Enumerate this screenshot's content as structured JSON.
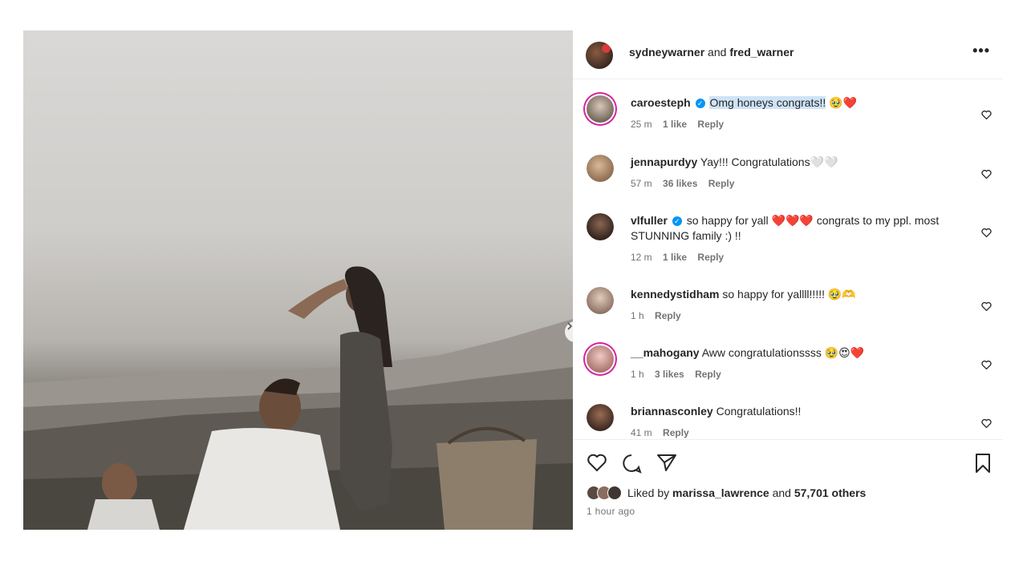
{
  "header": {
    "user1": "sydneywarner",
    "and_text": " and ",
    "user2": "fred_warner",
    "more_icon": "more-horizontal-icon"
  },
  "comments": [
    {
      "user": "caroesteph",
      "verified": true,
      "text": "Omg honeys congrats!!",
      "emoji": " 🥹❤️",
      "time": "25 m",
      "likes": "1 like",
      "reply": "Reply"
    },
    {
      "user": "jennapurdyy",
      "verified": false,
      "text": "Yay!!! Congratulations🤍🤍",
      "emoji": "",
      "time": "57 m",
      "likes": "36 likes",
      "reply": "Reply"
    },
    {
      "user": "vlfuller",
      "verified": true,
      "text": "so happy for yall ❤️❤️❤️ congrats to my ppl. most STUNNING family :) !!",
      "emoji": "",
      "time": "12 m",
      "likes": "1 like",
      "reply": "Reply"
    },
    {
      "user": "kennedystidham",
      "verified": false,
      "text": "so happy for yallll!!!!! 🥹🫶",
      "emoji": "",
      "time": "1 h",
      "likes": "",
      "reply": "Reply"
    },
    {
      "user": "__mahogany",
      "verified": false,
      "text": "Aww congratulationssss 🥹😍❤️",
      "emoji": "",
      "time": "1 h",
      "likes": "3 likes",
      "reply": "Reply"
    },
    {
      "user": "briannasconley",
      "verified": false,
      "text": "Congratulations!!",
      "emoji": "",
      "time": "41 m",
      "likes": "",
      "reply": "Reply"
    }
  ],
  "likes": {
    "liked_by": "Liked by ",
    "user": "marissa_lawrence",
    "and": " and ",
    "others": "57,701 others"
  },
  "time_ago": "1 hour ago",
  "colors": {
    "accent": "#0095f6",
    "text": "#262626",
    "muted": "#737373",
    "highlight": "#cfe3f7"
  }
}
